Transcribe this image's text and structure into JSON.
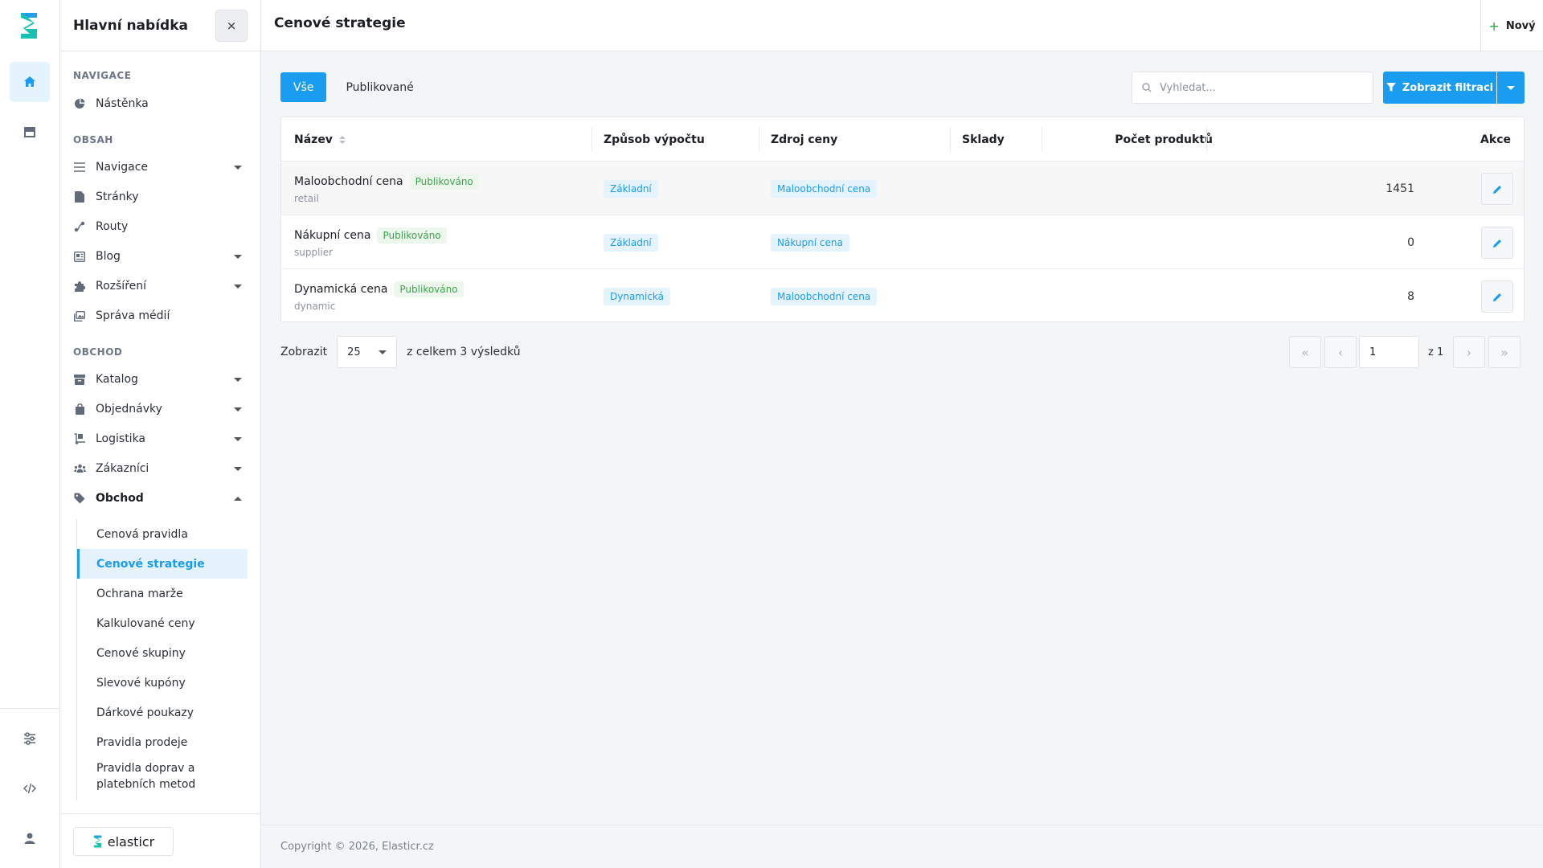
{
  "app": {
    "brand_name": "elasticr",
    "copyright": "Copyright © 2026, Elasticr.cz"
  },
  "colors": {
    "accent": "#1a9cf0",
    "success": "#3aa44a",
    "chip_bg": "#e5f3fd"
  },
  "rail": {
    "items": [
      {
        "icon": "home-icon",
        "active": true
      },
      {
        "icon": "store-icon",
        "active": false
      }
    ],
    "bottom_items": [
      {
        "icon": "sliders-icon"
      },
      {
        "icon": "code-icon"
      },
      {
        "icon": "user-icon"
      }
    ]
  },
  "sidebar": {
    "title": "Hlavní nabídka",
    "close_label": "×",
    "sections": {
      "navigace": "NAVIGACE",
      "obsah": "OBSAH",
      "obchod": "OBCHOD"
    },
    "items": {
      "nastenka": "Nástěnka",
      "navigace": "Navigace",
      "stranky": "Stránky",
      "routy": "Routy",
      "blog": "Blog",
      "rozsireni": "Rozšíření",
      "sprava_medii": "Správa médií",
      "katalog": "Katalog",
      "objednavky": "Objednávky",
      "logistika": "Logistika",
      "zakaznici": "Zákazníci",
      "obchod": "Obchod"
    },
    "sub_items": [
      "Cenová pravidla",
      "Cenové strategie",
      "Ochrana marže",
      "Kalkulované ceny",
      "Cenové skupiny",
      "Slevové kupóny",
      "Dárkové poukazy",
      "Pravidla prodeje",
      "Pravidla doprav a platebních metod"
    ]
  },
  "header": {
    "title": "Cenové strategie",
    "new_label": "Nový"
  },
  "toolbar": {
    "tabs": [
      "Vše",
      "Publikované"
    ],
    "search_placeholder": "Vyhledat...",
    "filter_label": "Zobrazit filtraci"
  },
  "table": {
    "columns": [
      "Název",
      "Způsob výpočtu",
      "Zdroj ceny",
      "Sklady",
      "Počet produktů",
      "Akce"
    ],
    "rows": [
      {
        "name": "Maloobchodní cena",
        "status": "Publikováno",
        "code": "retail",
        "method": "Základní",
        "source": "Maloobchodní cena",
        "warehouses": "",
        "products": "1451"
      },
      {
        "name": "Nákupní cena",
        "status": "Publikováno",
        "code": "supplier",
        "method": "Základní",
        "source": "Nákupní cena",
        "warehouses": "",
        "products": "0"
      },
      {
        "name": "Dynamická cena",
        "status": "Publikováno",
        "code": "dynamic",
        "method": "Dynamická",
        "source": "Maloobchodní cena",
        "warehouses": "",
        "products": "8"
      }
    ]
  },
  "pagination": {
    "show_label": "Zobrazit",
    "per_page": "25",
    "total_text": "z celkem 3 výsledků",
    "current_page": "1",
    "of_text": "z 1",
    "first": "«",
    "prev": "‹",
    "next": "›",
    "last": "»"
  }
}
